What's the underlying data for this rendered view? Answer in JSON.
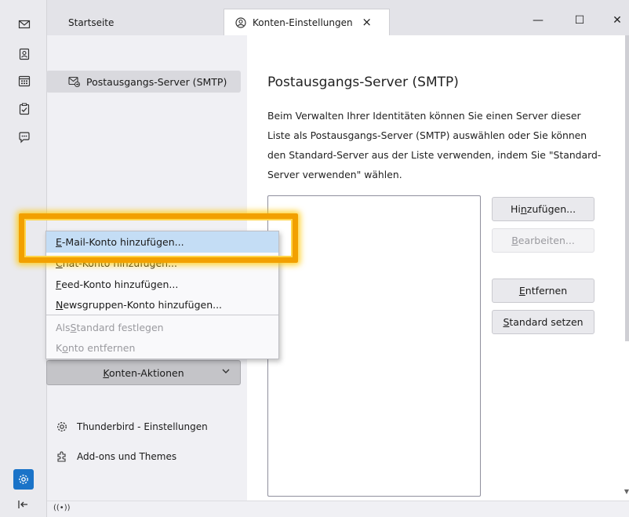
{
  "tabs": [
    {
      "label": "Startseite"
    },
    {
      "label": "Konten-Einstellungen",
      "close": "×"
    }
  ],
  "window_controls": {
    "minimize": "—",
    "maximize": "☐",
    "close": "✕"
  },
  "left_pane": {
    "account_item": "Postausgangs-Server (SMTP)",
    "actions_button": {
      "prefix": "",
      "underlined": "K",
      "rest": "onten-Aktionen"
    },
    "links": [
      {
        "label": "Thunderbird - Einstellungen",
        "icon": "gear-icon"
      },
      {
        "label": "Add-ons und Themes",
        "icon": "puzzle-icon"
      }
    ]
  },
  "main": {
    "title": "Postausgangs-Server (SMTP)",
    "description": "Beim Verwalten Ihrer Identitäten können Sie einen Server dieser Liste als Postausgangs-Server (SMTP) auswählen oder Sie können den Standard-Server aus der Liste verwenden, indem Sie \"Standard-Server verwenden\" wählen.",
    "buttons": {
      "add": {
        "prefix": "Hi",
        "underlined": "n",
        "rest": "zufügen..."
      },
      "edit": {
        "prefix": "",
        "underlined": "B",
        "rest": "earbeiten..."
      },
      "remove": {
        "prefix": "",
        "underlined": "E",
        "rest": "ntfernen"
      },
      "set_default": {
        "prefix": "",
        "underlined": "S",
        "rest": "tandard setzen"
      }
    }
  },
  "menu": {
    "items": [
      {
        "prefix": "",
        "underlined": "E",
        "rest": "-Mail-Konto hinzufügen..."
      },
      {
        "prefix": "",
        "underlined": "C",
        "rest": "hat-Konto hinzufügen..."
      },
      {
        "prefix": "",
        "underlined": "F",
        "rest": "eed-Konto hinzufügen..."
      },
      {
        "prefix": "",
        "underlined": "N",
        "rest": "ewsgruppen-Konto hinzufügen..."
      },
      {
        "prefix": "Als ",
        "underlined": "S",
        "rest": "tandard festlegen"
      },
      {
        "prefix": "K",
        "underlined": "o",
        "rest": "nto entfernen"
      }
    ]
  },
  "colors": {
    "accent": "#1a73c8",
    "highlight": "#f2a000"
  }
}
